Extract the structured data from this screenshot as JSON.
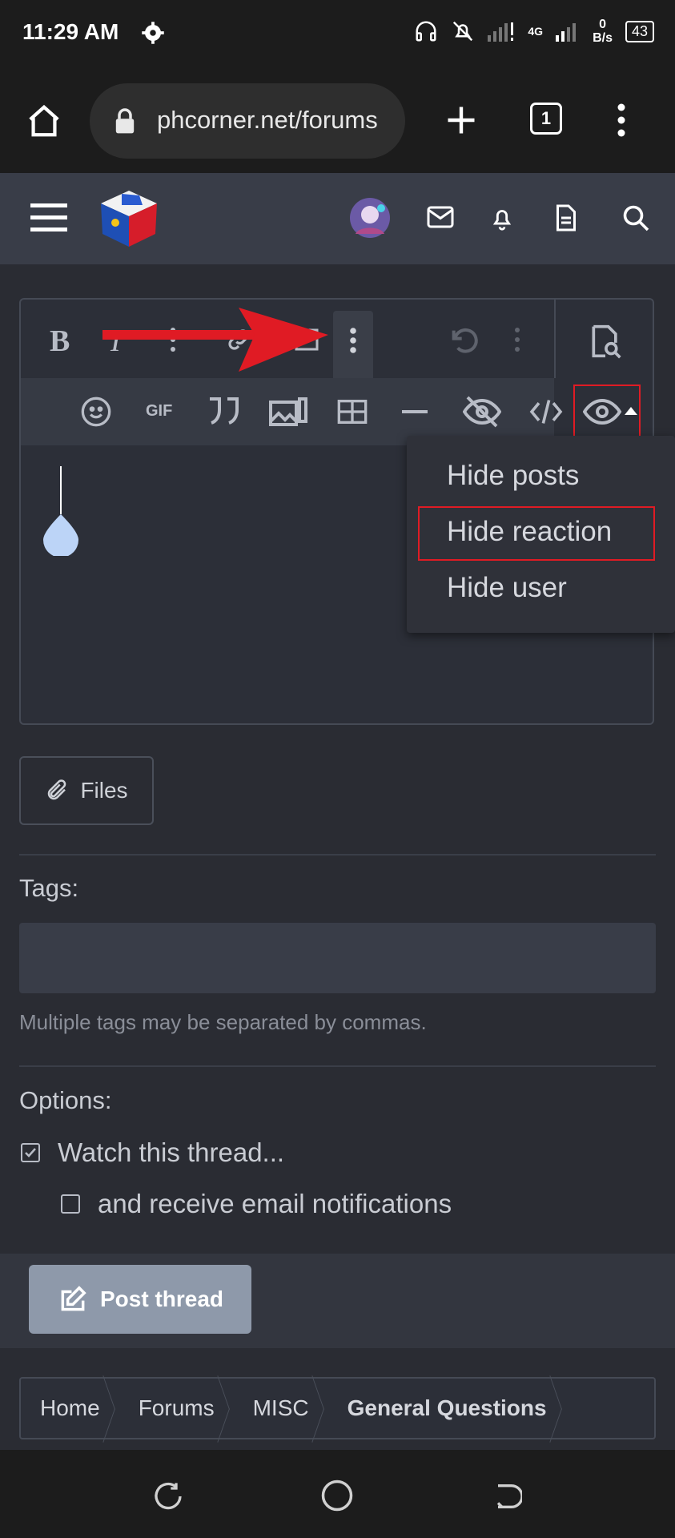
{
  "status": {
    "time": "11:29 AM",
    "network": "4G",
    "speed_value": "0",
    "speed_unit": "B/s",
    "battery": "43"
  },
  "browser": {
    "url": "phcorner.net/forums",
    "tab_count": "1"
  },
  "editor": {
    "toolbar_dropdown": {
      "items": [
        "Hide posts",
        "Hide reaction",
        "Hide user"
      ],
      "highlighted": "Hide reaction"
    },
    "gif_label": "GIF"
  },
  "files_button": "Files",
  "tags": {
    "label": "Tags:",
    "hint": "Multiple tags may be separated by commas."
  },
  "options": {
    "label": "Options:",
    "watch_label": "Watch this thread...",
    "watch_checked": true,
    "email_label": "and receive email notifications",
    "email_checked": false
  },
  "post_button": "Post thread",
  "breadcrumb": [
    "Home",
    "Forums",
    "MISC",
    "General Questions"
  ],
  "colors": {
    "accent": "#8e99aa",
    "highlight": "#e01b24",
    "arrow": "#e01b24",
    "cursor": "#bcd4f7"
  }
}
